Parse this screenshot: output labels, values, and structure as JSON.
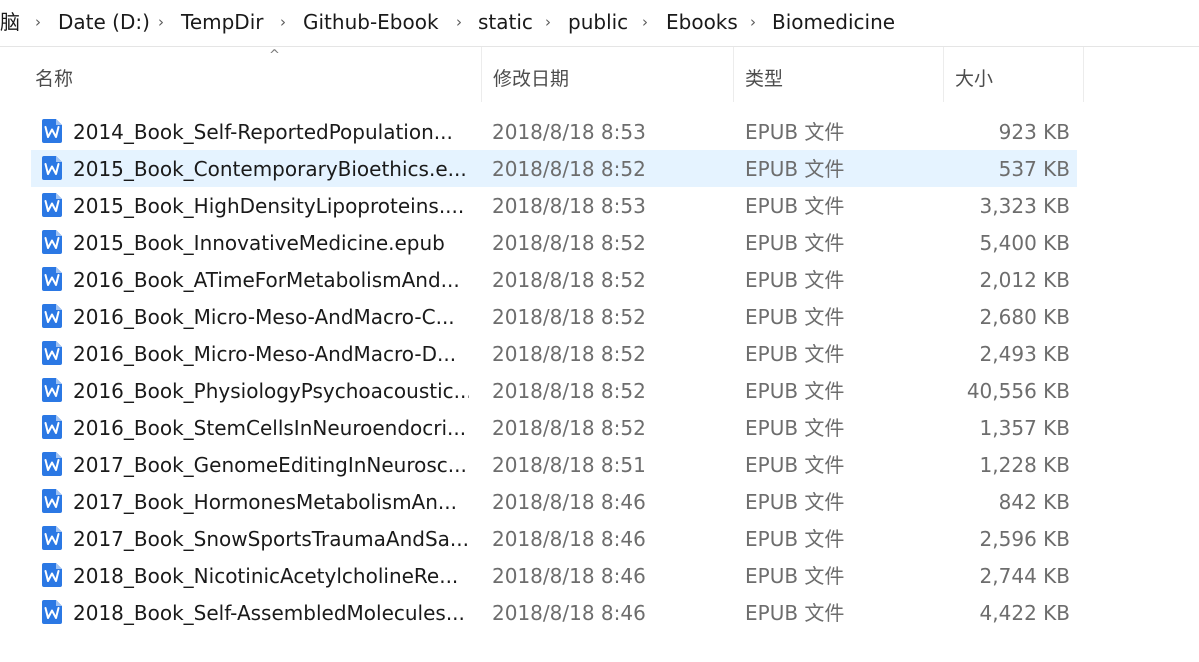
{
  "breadcrumb": {
    "items": [
      {
        "label": "脑"
      },
      {
        "label": "Date (D:)"
      },
      {
        "label": "TempDir"
      },
      {
        "label": "Github-Ebook"
      },
      {
        "label": "static"
      },
      {
        "label": "public"
      },
      {
        "label": "Ebooks"
      },
      {
        "label": "Biomedicine"
      }
    ],
    "separator": "›"
  },
  "columns": {
    "name": "名称",
    "date": "修改日期",
    "type": "类型",
    "size": "大小",
    "sort_indicator": "^"
  },
  "colors": {
    "selected_row": "#e5f3ff",
    "icon_blue": "#2b78e4"
  },
  "files": [
    {
      "name": "2014_Book_Self-ReportedPopulation...",
      "date": "2018/8/18 8:53",
      "type": "EPUB 文件",
      "size": "923 KB",
      "icon": "wps-doc-icon",
      "selected": false
    },
    {
      "name": "2015_Book_ContemporaryBioethics.e...",
      "date": "2018/8/18 8:52",
      "type": "EPUB 文件",
      "size": "537 KB",
      "icon": "wps-doc-icon",
      "selected": true
    },
    {
      "name": "2015_Book_HighDensityLipoproteins....",
      "date": "2018/8/18 8:53",
      "type": "EPUB 文件",
      "size": "3,323 KB",
      "icon": "wps-doc-icon",
      "selected": false
    },
    {
      "name": "2015_Book_InnovativeMedicine.epub",
      "date": "2018/8/18 8:52",
      "type": "EPUB 文件",
      "size": "5,400 KB",
      "icon": "wps-doc-icon",
      "selected": false
    },
    {
      "name": "2016_Book_ATimeForMetabolismAnd...",
      "date": "2018/8/18 8:52",
      "type": "EPUB 文件",
      "size": "2,012 KB",
      "icon": "wps-doc-icon",
      "selected": false
    },
    {
      "name": "2016_Book_Micro-Meso-AndMacro-C...",
      "date": "2018/8/18 8:52",
      "type": "EPUB 文件",
      "size": "2,680 KB",
      "icon": "wps-doc-icon",
      "selected": false
    },
    {
      "name": "2016_Book_Micro-Meso-AndMacro-D...",
      "date": "2018/8/18 8:52",
      "type": "EPUB 文件",
      "size": "2,493 KB",
      "icon": "wps-doc-icon",
      "selected": false
    },
    {
      "name": "2016_Book_PhysiologyPsychoacoustic...",
      "date": "2018/8/18 8:52",
      "type": "EPUB 文件",
      "size": "40,556 KB",
      "icon": "wps-doc-icon",
      "selected": false
    },
    {
      "name": "2016_Book_StemCellsInNeuroendocri...",
      "date": "2018/8/18 8:52",
      "type": "EPUB 文件",
      "size": "1,357 KB",
      "icon": "wps-doc-icon",
      "selected": false
    },
    {
      "name": "2017_Book_GenomeEditingInNeurosc...",
      "date": "2018/8/18 8:51",
      "type": "EPUB 文件",
      "size": "1,228 KB",
      "icon": "wps-doc-icon",
      "selected": false
    },
    {
      "name": "2017_Book_HormonesMetabolismAn...",
      "date": "2018/8/18 8:46",
      "type": "EPUB 文件",
      "size": "842 KB",
      "icon": "wps-doc-icon",
      "selected": false
    },
    {
      "name": "2017_Book_SnowSportsTraumaAndSa...",
      "date": "2018/8/18 8:46",
      "type": "EPUB 文件",
      "size": "2,596 KB",
      "icon": "wps-doc-icon",
      "selected": false
    },
    {
      "name": "2018_Book_NicotinicAcetylcholineRe...",
      "date": "2018/8/18 8:46",
      "type": "EPUB 文件",
      "size": "2,744 KB",
      "icon": "wps-doc-icon",
      "selected": false
    },
    {
      "name": "2018_Book_Self-AssembledMolecules...",
      "date": "2018/8/18 8:46",
      "type": "EPUB 文件",
      "size": "4,422 KB",
      "icon": "wps-doc-icon",
      "selected": false
    }
  ]
}
